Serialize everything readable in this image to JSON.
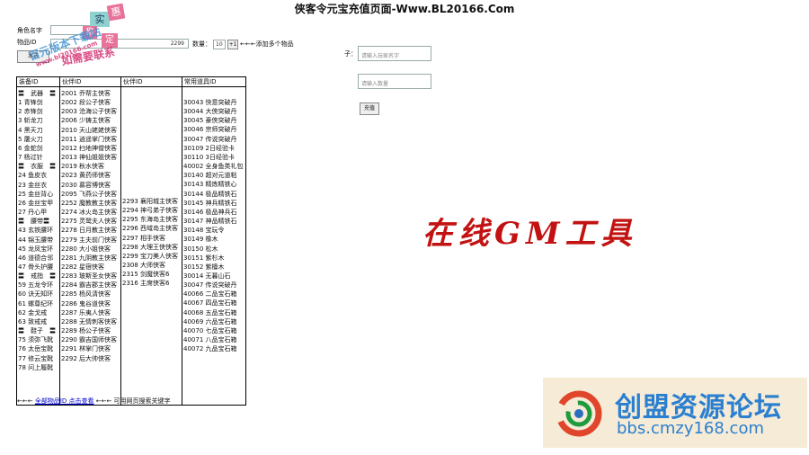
{
  "page_title": "侠客令元宝充值页面-Www.BL20166.Com",
  "form": {
    "role_label": "角色名字",
    "item_label": "物品ID",
    "item_value": "2299",
    "qty_label": "数量：",
    "qty_value": "10",
    "add_button": "+1",
    "add_hint": "←←←添加多个物品",
    "send_button": "发送"
  },
  "right_form": {
    "label": "子：",
    "name_placeholder": "请输入玩家名字",
    "amount_placeholder": "请输入数量",
    "submit": "充值"
  },
  "watermark": {
    "badge1": "实",
    "badge2": "惠",
    "badge3": "稳",
    "badge4": "定",
    "line1": "百元版本下载站",
    "line2": "www.bl20166.com",
    "line3": "如需要联系"
  },
  "table": {
    "headers": [
      "装备ID",
      "伙伴ID",
      "伙伴ID",
      "常用道具ID"
    ],
    "col1": [
      "〓　武器　〓",
      "1 青锋剑",
      "2 赤锋剑",
      "3 斩龙刀",
      "4 黑天刀",
      "5 屠火刀",
      "6 金蛇剑",
      "7 杨过针",
      "〓　衣服　〓",
      "24 鱼皮衣",
      "23 金丝衣",
      "25 金丝背心",
      "26 金丝宝甲",
      "27 丹心甲",
      "〓　腰带〓",
      "43 玄铁腰环",
      "44 锦玉腰带",
      "45 龙凤宝环",
      "46 道德合邻",
      "47 骨头护腰",
      "〓　戒指　〓",
      "59 五龙令环",
      "60 诀无知环",
      "61 螺尊纪环",
      "62 金戈戒",
      "63 致戒戒",
      "〓　鞋子　〓",
      "75 须弥飞靴",
      "76 太岳宝靴",
      "77 修云宝靴",
      "78 问上履靴"
    ],
    "col2": [
      "2001 乔帮主侠客",
      "2002 段公子侠客",
      "2003 沧海公子侠客",
      "2006 少铸主侠客",
      "2010 天山姥姥侠客",
      "2011 逍遥掌门侠客",
      "2012 扫地神僧侠客",
      "2013 神仙姐姐侠客",
      "2019 秋水侠客",
      "2023 黄药师侠客",
      "2030 慕容博侠客",
      "2095 飞燕公子侠客",
      "2252 魔教教主侠客",
      "2274 冰火岛主侠客",
      "2275 灵鹫夫人侠客",
      "2278 日月教主侠客",
      "2279 主夫前门侠客",
      "2280 大小姐侠客",
      "2281 九阴教主侠客",
      "2282 星宿侠客",
      "2283 玻斯圣女侠客",
      "2284 霸吉郡主侠客",
      "2285 杨风清侠客",
      "2286 鬼谷道侠客",
      "2287 乐夷人侠客",
      "2288 无情刺客侠客",
      "2289 杨公子侠客",
      "2290 霸吉国师侠客",
      "2291 林掌门侠客",
      "2292 后大帅侠客"
    ],
    "col3": [
      "2293 襄阳城主侠客",
      "2294 神弓弟子侠客",
      "2295 东海岛主侠客",
      "2296 西域岛主侠客",
      "2297 相手侠客",
      "2298 大理王侠侠客",
      "2299 宝刀美人侠客",
      "2308 大师侠客",
      "2315 剑魔侠客6",
      "2316 主席侠客6"
    ],
    "col4": [
      "30043 快意突破丹",
      "30044 大侠突破丹",
      "30045 豪侠突破丹",
      "30046 宗师突破丹",
      "30047 传说突破丹",
      "30109 2日经验卡",
      "30110 3日经验卡",
      "40002 全身鱼类礼包",
      "30140 超对元道粘",
      "30143 精炼精铁心",
      "30144 极品精铁石",
      "30145 神兵精铁石",
      "30146 极品神兵石",
      "30147 神品精铁石",
      "30148 宝玩令",
      "30149 橡木",
      "30150 松木",
      "30151 紫杉木",
      "30152 紫檀木",
      "30014 无暮山石",
      "30047 传说突破丹",
      "40066 二品宝石箱",
      "40067 四品宝石箱",
      "40068 五品宝石箱",
      "40069 六品宝石箱",
      "40070 七品宝石箱",
      "40071 八品宝石箱",
      "40072 九品宝石箱"
    ]
  },
  "footer": {
    "prefix": "←←← ",
    "link": "全部物品ID 点击查看",
    "suffix": " ←←← 可用网页搜索关键字"
  },
  "gm_text": "在线GM工具",
  "cm_logo": {
    "title": "创盟资源论坛",
    "url": "bbs.cmzy168.com"
  }
}
